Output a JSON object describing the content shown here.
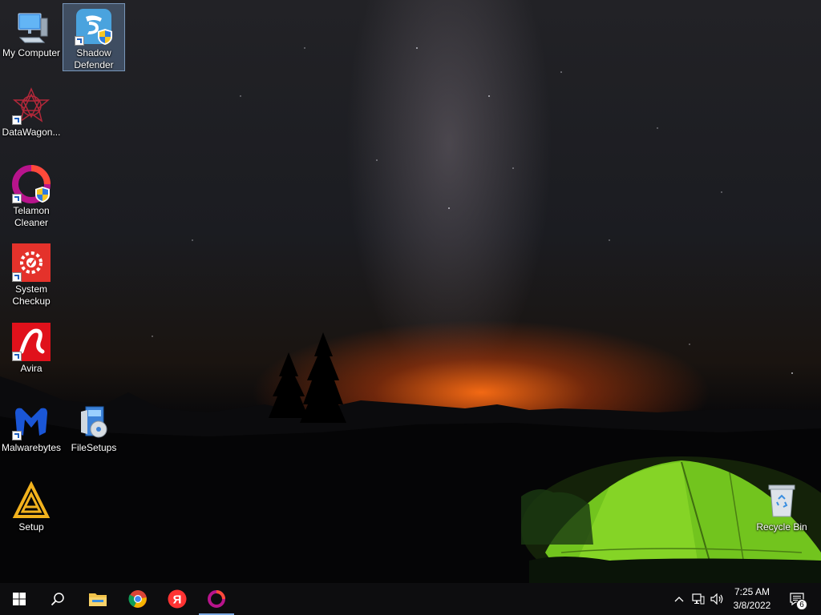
{
  "desktop": {
    "icons": [
      {
        "label": "My Computer"
      },
      {
        "label": "Shadow\nDefender"
      },
      {
        "label": "DataWagon..."
      },
      {
        "label": "Telamon\nCleaner"
      },
      {
        "label": "System\nCheckup"
      },
      {
        "label": "Avira"
      },
      {
        "label": "Malwarebytes"
      },
      {
        "label": "FileSetups"
      },
      {
        "label": "Setup"
      },
      {
        "label": "Recycle Bin"
      }
    ]
  },
  "taskbar": {
    "pinned": [
      "windows-start",
      "search",
      "file-explorer",
      "google-chrome",
      "yandex-browser",
      "telamon-cleaner"
    ],
    "clock": {
      "time": "7:25 AM",
      "date": "3/8/2022"
    },
    "notification_count": "6"
  }
}
